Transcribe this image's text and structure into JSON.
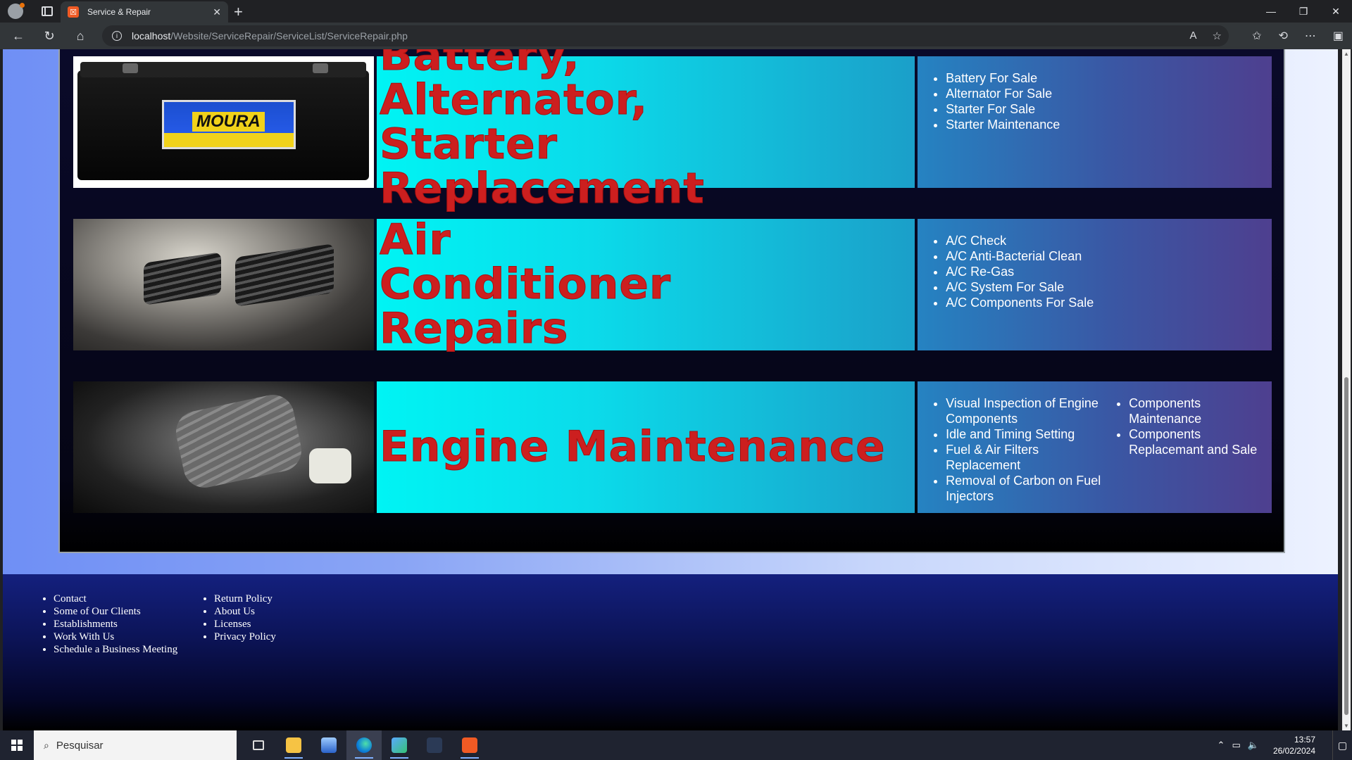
{
  "browser": {
    "tab_title": "Service & Repair",
    "tab_favicon": "xampp-icon",
    "new_tab": "+",
    "url_host": "localhost",
    "url_path": "/Website/ServiceRepair/ServiceList/ServiceRepair.php"
  },
  "services": [
    {
      "title": "Battery, Alternator, Starter Replacement",
      "image": "car-battery",
      "items_col1": [
        "Battery For Sale",
        "Alternator For Sale",
        "Starter For Sale",
        "Starter Maintenance"
      ],
      "items_col2": []
    },
    {
      "title": "Air Conditioner Repairs",
      "image": "car-air-vent",
      "items_col1": [
        "A/C Check",
        "A/C Anti-Bacterial Clean",
        "A/C Re-Gas",
        "A/C System For Sale",
        "A/C Components For Sale"
      ],
      "items_col2": []
    },
    {
      "title": "Engine Maintenance",
      "image": "car-engine",
      "items_col1": [
        "Visual Inspection of Engine Components",
        "Idle and Timing Setting",
        "Fuel & Air Filters Replacement",
        "Removal of Carbon on Fuel Injectors"
      ],
      "items_col2": [
        "Components Maintenance",
        "Components Replacemant and Sale"
      ]
    }
  ],
  "footer": {
    "col1": [
      "Contact",
      "Some of Our Clients",
      "Establishments",
      "Work With Us",
      "Schedule a Business Meeting"
    ],
    "col2": [
      "Return Policy",
      "About Us",
      "Licenses",
      "Privacy Policy"
    ]
  },
  "taskbar": {
    "search_placeholder": "Pesquisar",
    "time": "13:57",
    "date": "26/02/2024"
  },
  "colors": {
    "title_red": "#cc1f1f",
    "title_box_cyan": "#00f4f4",
    "list_box_blue": "#3a57a4",
    "footer_navy": "#14207e"
  }
}
